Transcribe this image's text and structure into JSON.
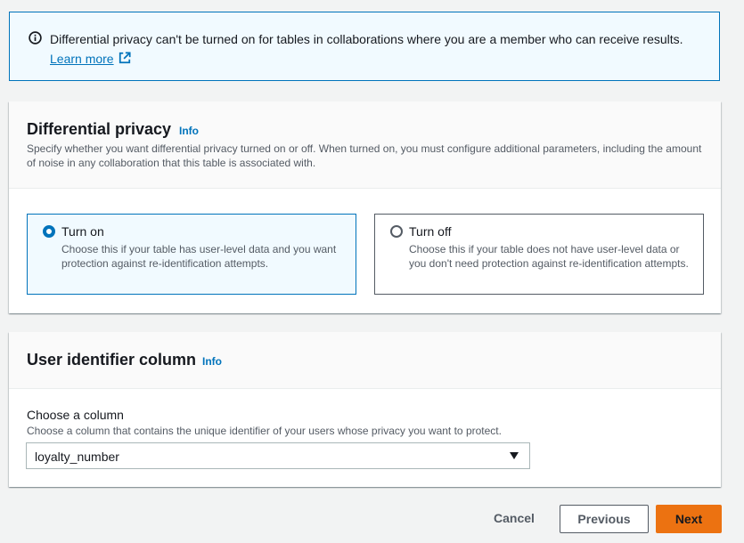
{
  "alert": {
    "message": "Differential privacy can't be turned on for tables in collaborations where you are a member who can receive results.",
    "link_label": "Learn more",
    "icon": "info-circle-icon",
    "link_icon": "external-link-icon"
  },
  "differential_privacy": {
    "title": "Differential privacy",
    "info_label": "Info",
    "description": "Specify whether you want differential privacy turned on or off. When turned on, you must configure additional parameters, including the amount of noise in any collaboration that this table is associated with.",
    "options": [
      {
        "label": "Turn on",
        "description": "Choose this if your table has user-level data and you want protection against re-identification attempts.",
        "selected": true
      },
      {
        "label": "Turn off",
        "description": "Choose this if your table does not have user-level data or you don't need protection against re-identification attempts.",
        "selected": false
      }
    ]
  },
  "user_identifier": {
    "title": "User identifier column",
    "info_label": "Info",
    "field_label": "Choose a column",
    "field_description": "Choose a column that contains the unique identifier of your users whose privacy you want to protect.",
    "selected_value": "loyalty_number"
  },
  "actions": {
    "cancel": "Cancel",
    "previous": "Previous",
    "next": "Next"
  },
  "colors": {
    "accent": "#0073bb",
    "primary_button": "#ec7211",
    "alert_background": "#f1faff"
  }
}
